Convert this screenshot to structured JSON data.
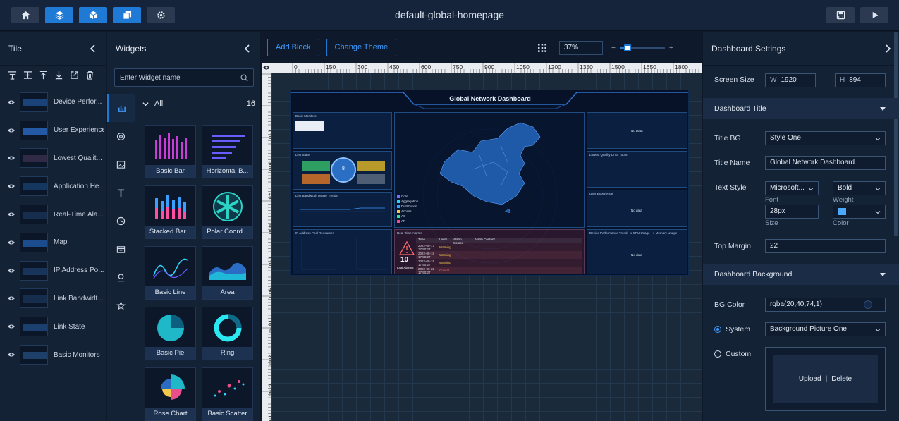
{
  "app_title": "default-global-homepage",
  "topbar": {
    "left_buttons": [
      {
        "icon": "home-icon",
        "active": false
      },
      {
        "icon": "layers-icon",
        "active": true
      },
      {
        "icon": "cube-icon",
        "active": true
      },
      {
        "icon": "copy-icon",
        "active": true
      },
      {
        "icon": "gear-icon",
        "active": false
      }
    ],
    "right_buttons": [
      {
        "icon": "save-icon"
      },
      {
        "icon": "play-icon"
      }
    ]
  },
  "tile_panel": {
    "title": "Tile",
    "items": [
      {
        "label": "Device Perfor..."
      },
      {
        "label": "User Experience"
      },
      {
        "label": "Lowest Qualit..."
      },
      {
        "label": "Application He..."
      },
      {
        "label": "Real-Time Ala..."
      },
      {
        "label": "Map"
      },
      {
        "label": "IP Address Po..."
      },
      {
        "label": "Link Bandwidt..."
      },
      {
        "label": "Link State"
      },
      {
        "label": "Basic Monitors"
      }
    ]
  },
  "widget_panel": {
    "title": "Widgets",
    "search_placeholder": "Enter Widget name",
    "group_label": "All",
    "group_count": "16",
    "widgets": [
      {
        "label": "Basic Bar"
      },
      {
        "label": "Horizontal B..."
      },
      {
        "label": "Stacked Bar..."
      },
      {
        "label": "Polar Coord..."
      },
      {
        "label": "Basic Line"
      },
      {
        "label": "Area"
      },
      {
        "label": "Basic Pie"
      },
      {
        "label": "Ring"
      },
      {
        "label": "Rose Chart"
      },
      {
        "label": "Basic Scatter"
      }
    ]
  },
  "canvas": {
    "add_block": "Add Block",
    "change_theme": "Change Theme",
    "zoom": "37%",
    "zoom_minus": "−",
    "zoom_plus": "+",
    "zoom_fraction": 0.37,
    "ruler_top": [
      "0",
      "150",
      "300",
      "450",
      "600",
      "750",
      "900",
      "1050",
      "1200",
      "1350",
      "1500",
      "1650",
      "1800",
      "19"
    ],
    "ruler_left": [
      "150",
      "300",
      "450",
      "600",
      "750",
      "900",
      "1050",
      "1200",
      "1350",
      "1500"
    ],
    "dashboard": {
      "title": "Global Network Dashboard",
      "basic_monitors": "Basic Monitors",
      "link_state": "Link State",
      "link_bw": "Link Bandwidth Usage Trends",
      "ip_pool": "IP Address Pool Resources",
      "real_time": "Real-Time Alarms",
      "lowest_quality": "Lowest Quality Links Top 5",
      "user_exp": "User Experience",
      "device_perf": "Device Performance Trend",
      "no_data": "No data",
      "no_data_cap": "No Data",
      "total_alarms_value": "10",
      "total_alarms_label": "Total Alarms",
      "link_state_total": "8",
      "legend_cpu": "CPU Usage",
      "legend_mem": "Memory Usage",
      "alarm_cols": [
        "Time",
        "Level",
        "Alarm Source",
        "Alarm Content"
      ],
      "alarm_rows": [
        {
          "time": "2022-08-17 17:50:27",
          "level": "Warning"
        },
        {
          "time": "2022-08-18 17:50:27",
          "level": "Warning"
        },
        {
          "time": "2022-08-19 17:50:27",
          "level": "Warning"
        },
        {
          "time": "2022-08-22 17:50:27",
          "level": "Critical"
        }
      ],
      "map_legend": [
        "Core",
        "Aggregation",
        "Distribution",
        "Access",
        "AC",
        "AP"
      ]
    }
  },
  "settings": {
    "title": "Dashboard Settings",
    "screen_size_label": "Screen Size",
    "width_prefix": "W",
    "width": "1920",
    "height_prefix": "H",
    "height": "894",
    "section_title": "Dashboard Title",
    "title_bg_label": "Title BG",
    "title_bg_value": "Style One",
    "title_name_label": "Title Name",
    "title_name_value": "Global Network Dashboard",
    "text_style_label": "Text Style",
    "font_value": "Microsoft...",
    "weight_value": "Bold",
    "font_caption": "Font",
    "weight_caption": "Weight",
    "size_value": "28px",
    "size_caption": "Size",
    "color_caption": "Color",
    "title_color": "#4aa8ff",
    "top_margin_label": "Top Margin",
    "top_margin_value": "22",
    "bg_section_title": "Dashboard Background",
    "bg_color_label": "BG Color",
    "bg_color_value": "rgba(20,40,74,1)",
    "system_label": "System",
    "system_value": "Background Picture One",
    "custom_label": "Custom",
    "upload_label": "Upload",
    "separator": "|",
    "delete_label": "Delete"
  },
  "colors": {
    "accent": "#1f7ad6",
    "panel": "#142236",
    "topbar": "#15243a"
  }
}
